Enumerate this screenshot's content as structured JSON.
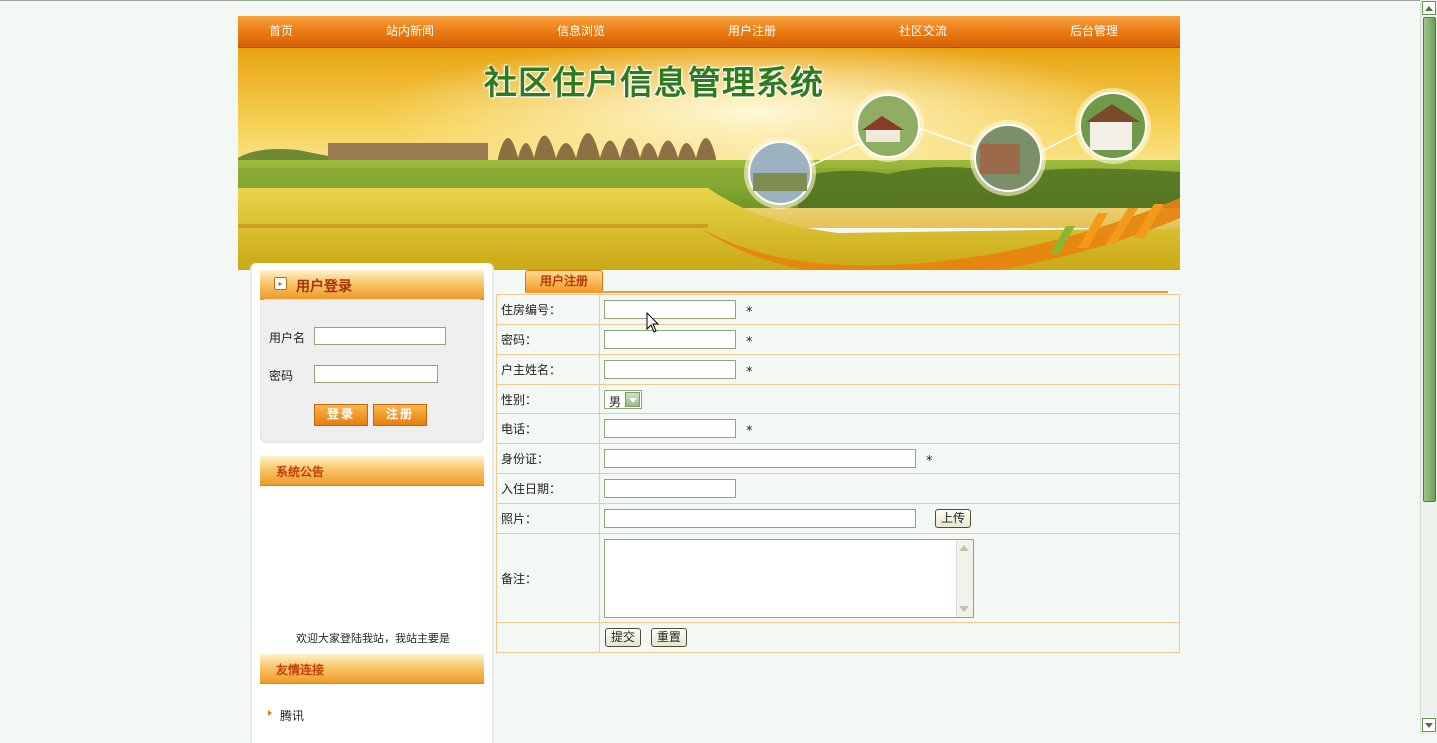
{
  "nav": {
    "items": [
      "首页",
      "站内新闻",
      "信息浏览",
      "用户注册",
      "社区交流",
      "后台管理"
    ]
  },
  "banner": {
    "title": "社区住户信息管理系统"
  },
  "login": {
    "header": "用户登录",
    "username_label": "用户名",
    "password_label": "密码",
    "login_button": "登录",
    "register_button": "注册"
  },
  "notice": {
    "header": "系统公告",
    "text": "欢迎大家登陆我站，我站主要是"
  },
  "links": {
    "header": "友情连接",
    "items": [
      "腾讯"
    ]
  },
  "form": {
    "tab_label": "用户注册",
    "fields": {
      "house_no": "住房编号：",
      "password": "密码：",
      "owner_name": "户主姓名：",
      "gender": "性别：",
      "phone": "电话：",
      "id_card": "身份证：",
      "move_in_date": "入住日期：",
      "photo": "照片：",
      "remarks": "备注："
    },
    "required_mark": "*",
    "gender_value": "男",
    "upload_button": "上传",
    "submit_button": "提交",
    "reset_button": "重置"
  },
  "colors": {
    "nav_orange": "#e9780f",
    "accent_red": "#c2410c",
    "input_border": "#8fa676",
    "form_border": "#f2c98e"
  }
}
